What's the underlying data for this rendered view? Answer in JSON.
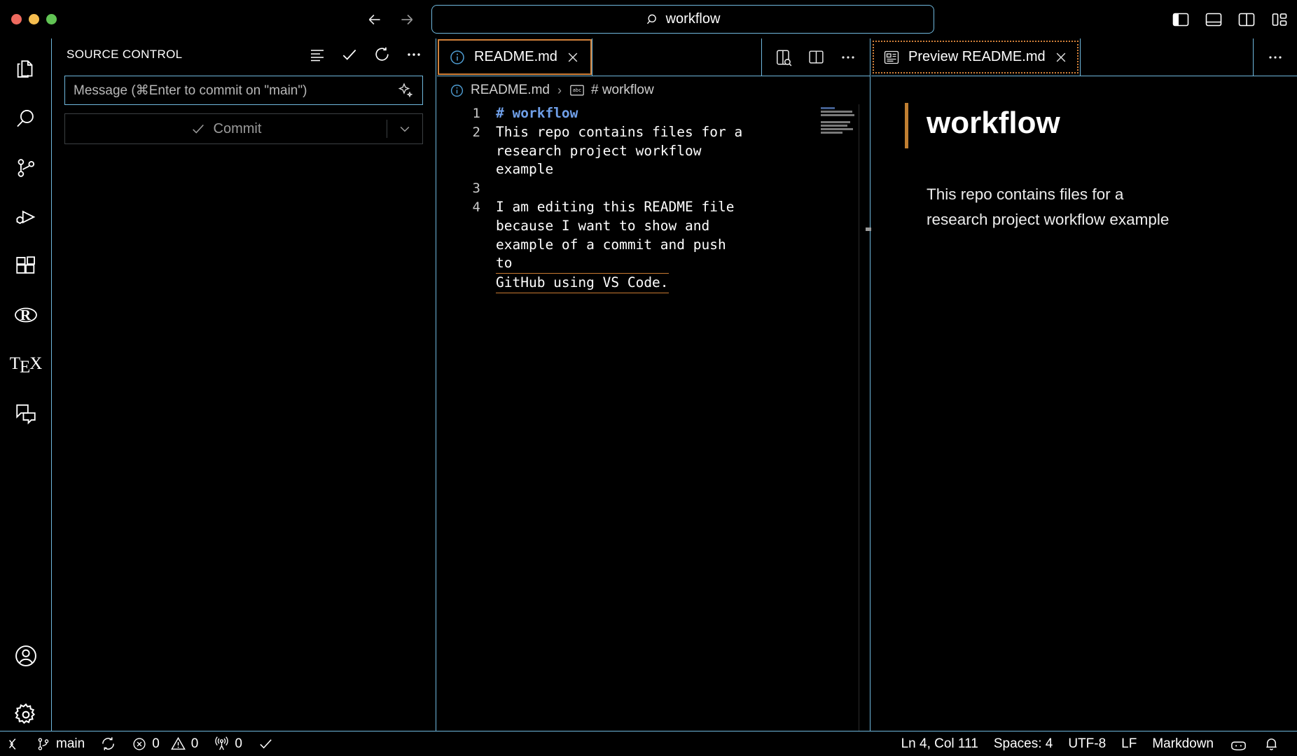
{
  "titlebar": {
    "window_controls": [
      "close",
      "minimize",
      "maximize"
    ],
    "nav": {
      "back": "back-arrow",
      "forward": "forward-arrow"
    },
    "command_center": {
      "icon": "search-icon",
      "text": "workflow"
    },
    "layout_actions": [
      {
        "name": "toggle-primary-sidebar",
        "label": "Toggle Primary Side Bar"
      },
      {
        "name": "toggle-panel",
        "label": "Toggle Panel"
      },
      {
        "name": "toggle-secondary-sidebar",
        "label": "Toggle Secondary Side Bar"
      },
      {
        "name": "customize-layout",
        "label": "Customize Layout"
      }
    ]
  },
  "activitybar": {
    "items": [
      {
        "icon": "explorer-icon",
        "label": "Explorer"
      },
      {
        "icon": "search-icon",
        "label": "Search"
      },
      {
        "icon": "source-control-icon",
        "label": "Source Control"
      },
      {
        "icon": "run-and-debug-icon",
        "label": "Run and Debug"
      },
      {
        "icon": "extensions-icon",
        "label": "Extensions"
      },
      {
        "icon": "r-language-icon",
        "label": "R"
      },
      {
        "icon": "latex-icon",
        "label": "TeX"
      },
      {
        "icon": "chat-icon",
        "label": "Chat"
      }
    ],
    "bottom_items": [
      {
        "icon": "account-icon",
        "label": "Accounts"
      },
      {
        "icon": "gear-icon",
        "label": "Manage"
      }
    ]
  },
  "sidebar": {
    "title": "SOURCE CONTROL",
    "actions": [
      {
        "icon": "view-as-list-icon",
        "label": "View as Tree"
      },
      {
        "icon": "check-icon",
        "label": "Commit"
      },
      {
        "icon": "refresh-icon",
        "label": "Refresh"
      },
      {
        "icon": "more-actions-icon",
        "label": "Views and More Actions..."
      }
    ],
    "commit_message": {
      "value": "",
      "placeholder": "Message (⌘Enter to commit on \"main\")",
      "sparkle_icon": "sparkle-icon"
    },
    "commit_button": {
      "label": "Commit",
      "check_icon": "check-icon",
      "dropdown_icon": "chevron-down-icon"
    }
  },
  "editor_left": {
    "tab": {
      "label": "README.md",
      "icon": "info-icon",
      "close_icon": "close-icon",
      "state": "focused"
    },
    "actions": [
      {
        "icon": "open-preview-icon",
        "label": "Open Preview to the Side"
      },
      {
        "icon": "split-editor-icon",
        "label": "Split Editor Right"
      },
      {
        "icon": "more-actions-icon",
        "label": "More Actions..."
      }
    ],
    "breadcrumb": {
      "file": "README.md",
      "file_icon": "info-icon",
      "separator": "›",
      "symbol_icon": "abc-symbol-icon",
      "symbol": "# workflow"
    },
    "code": {
      "lines": [
        {
          "number": "1",
          "text": "# workflow",
          "kind": "heading",
          "wrapped": []
        },
        {
          "number": "2",
          "text": "This repo contains files for a research project workflow example",
          "kind": "text",
          "wrapped": [
            "This repo contains files for a",
            "research project workflow example"
          ]
        },
        {
          "number": "3",
          "text": "",
          "kind": "text",
          "wrapped": [
            ""
          ]
        },
        {
          "number": "4",
          "text": "I am editing this README file because I want to show and example of a commit and push to GitHub using VS Code.",
          "kind": "text",
          "wrapped": [
            "I am editing this README file",
            "because I want to show and",
            "example of a commit and push to",
            "GitHub using VS Code."
          ]
        }
      ]
    }
  },
  "editor_right": {
    "tab": {
      "label": "Preview README.md",
      "icon": "preview-icon",
      "close_icon": "close-icon",
      "state": "unfocused-active"
    },
    "actions": [
      {
        "icon": "more-actions-icon",
        "label": "More Actions..."
      }
    ],
    "preview": {
      "heading": "workflow",
      "paragraph": "This repo contains files for a research project workflow example"
    }
  },
  "statusbar": {
    "left": [
      {
        "name": "remote-indicator",
        "icon": "remote-icon",
        "text": ""
      },
      {
        "name": "branch",
        "icon": "git-branch-icon",
        "text": "main"
      },
      {
        "name": "sync-changes",
        "icon": "sync-icon",
        "text": ""
      },
      {
        "name": "problems",
        "icon": "error-icon",
        "text": "0",
        "icon2": "warning-icon",
        "text2": "0"
      },
      {
        "name": "ports",
        "icon": "radio-tower-icon",
        "text": "0"
      },
      {
        "name": "checks",
        "icon": "check-icon",
        "text": ""
      }
    ],
    "right": [
      {
        "name": "editor-position",
        "text": "Ln 4, Col 111"
      },
      {
        "name": "editor-indentation",
        "text": "Spaces: 4"
      },
      {
        "name": "editor-encoding",
        "text": "UTF-8"
      },
      {
        "name": "editor-eol",
        "text": "LF"
      },
      {
        "name": "editor-language",
        "text": "Markdown"
      },
      {
        "name": "copilot-status",
        "icon": "copilot-icon",
        "text": ""
      },
      {
        "name": "notifications",
        "icon": "bell-icon",
        "text": ""
      }
    ]
  },
  "colors": {
    "background": "#000000",
    "border": "#6fb8dd",
    "accent_orange": "#c97a32",
    "heading_blue": "#6f9fe8"
  }
}
